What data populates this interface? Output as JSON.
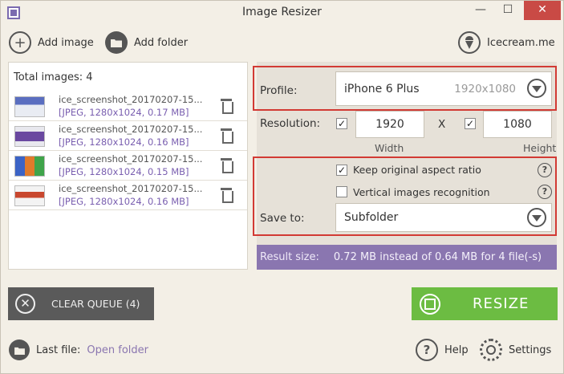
{
  "window": {
    "title": "Image Resizer",
    "minimize": "—",
    "maximize": "☐",
    "close": "✕"
  },
  "toolbar": {
    "add_image": "Add image",
    "add_folder": "Add folder",
    "brand_link": "Icecream.me"
  },
  "queue": {
    "total_label": "Total images: 4",
    "files": [
      {
        "name": "ice_screenshot_20170207-15...",
        "info": "[JPEG, 1280x1024, 0.17 MB]"
      },
      {
        "name": "ice_screenshot_20170207-15...",
        "info": "[JPEG, 1280x1024, 0.16 MB]"
      },
      {
        "name": "ice_screenshot_20170207-15...",
        "info": "[JPEG, 1280x1024, 0.15 MB]"
      },
      {
        "name": "ice_screenshot_20170207-15...",
        "info": "[JPEG, 1280x1024, 0.16 MB]"
      }
    ]
  },
  "settings": {
    "profile_label": "Profile:",
    "profile_value": "iPhone 6 Plus",
    "profile_resolution": "1920x1080",
    "resolution_label": "Resolution:",
    "width_value": "1920",
    "height_value": "1080",
    "times": "X",
    "width_label": "Width",
    "height_label": "Height",
    "keep_aspect": "Keep original aspect ratio",
    "keep_aspect_checked": true,
    "vertical_recognition": "Vertical images recognition",
    "vertical_recognition_checked": false,
    "save_to_label": "Save to:",
    "save_to_value": "Subfolder",
    "help": "?"
  },
  "result": {
    "label": "Result size:",
    "value": "0.72 MB instead of 0.64 MB for 4 file(-s)"
  },
  "actions": {
    "clear_queue": "CLEAR QUEUE (4)",
    "resize": "RESIZE"
  },
  "footer": {
    "last_file_label": "Last file:",
    "open_folder": "Open folder",
    "help": "Help",
    "settings": "Settings"
  },
  "colors": {
    "accent_purple": "#8a76b0",
    "resize_green": "#6cbc42",
    "highlight_red": "#d23a34",
    "close_red": "#c94a45"
  }
}
